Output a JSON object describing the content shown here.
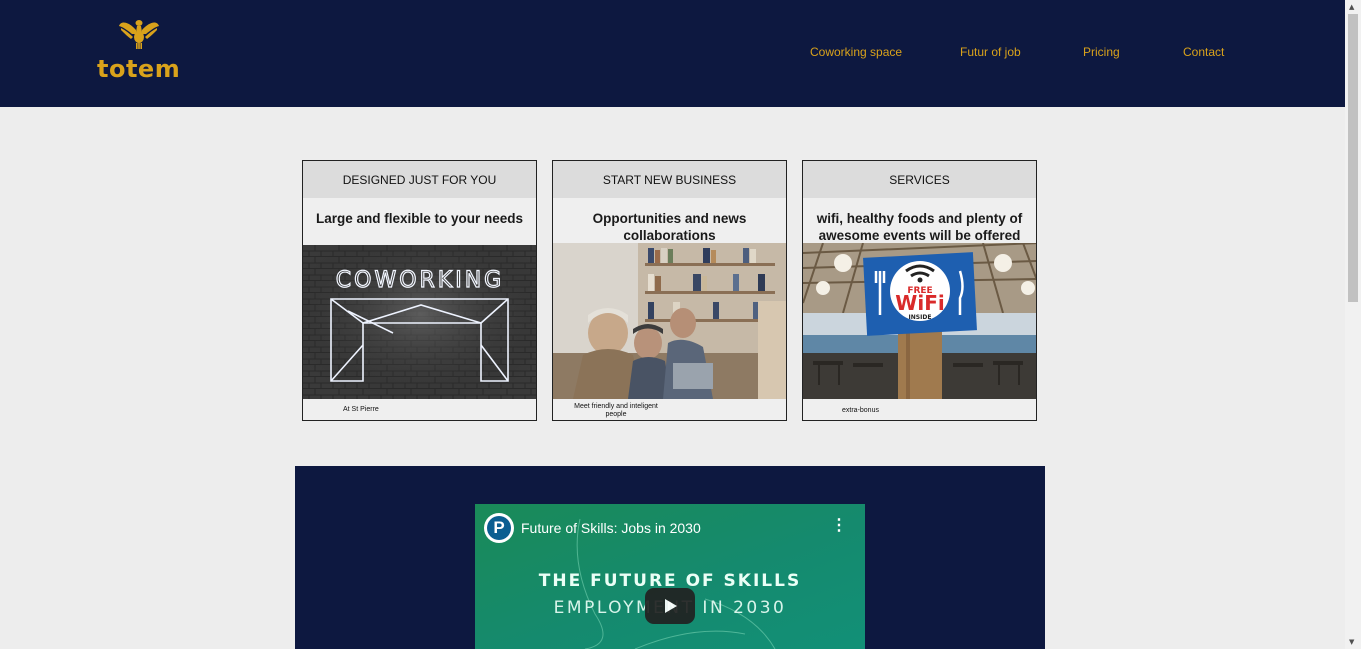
{
  "brand": {
    "name": "totem",
    "logo_icon": "winged-scarab-icon",
    "color": "#d9a21b"
  },
  "nav": {
    "items": [
      {
        "label": "Coworking space"
      },
      {
        "label": "Futur of job"
      },
      {
        "label": "Pricing"
      },
      {
        "label": "Contact"
      }
    ]
  },
  "cards": [
    {
      "title": "DESIGNED JUST FOR YOU",
      "subtitle": "Large and flexible to your needs",
      "image": "coworking-neon-sign",
      "caption": "At St Pierre"
    },
    {
      "title": "START NEW BUSINESS",
      "subtitle": "Opportunities and news collaborations",
      "image": "people-working-in-library",
      "caption_line1": "Meet friendly and inteligent",
      "caption_line2": "people"
    },
    {
      "title": "SERVICES",
      "subtitle": "wifi, healthy foods and plenty of awesome events will be offered",
      "image": "free-wifi-sign",
      "caption": "extra-bonus",
      "wifi_sign": {
        "free": "FREE",
        "wifi": "WiFi",
        "inside": "INSIDE"
      }
    }
  ],
  "neon_text": "COWORKING",
  "video": {
    "title": "Future of Skills: Jobs in 2030",
    "channel_initial": "P",
    "headline": "THE FUTURE OF SKILLS",
    "subline": "EMPLOYMENT IN 2030",
    "more_icon": "⋮"
  },
  "colors": {
    "header_bg": "#0d1840",
    "accent": "#d9a21b",
    "page_bg": "#ededed"
  }
}
